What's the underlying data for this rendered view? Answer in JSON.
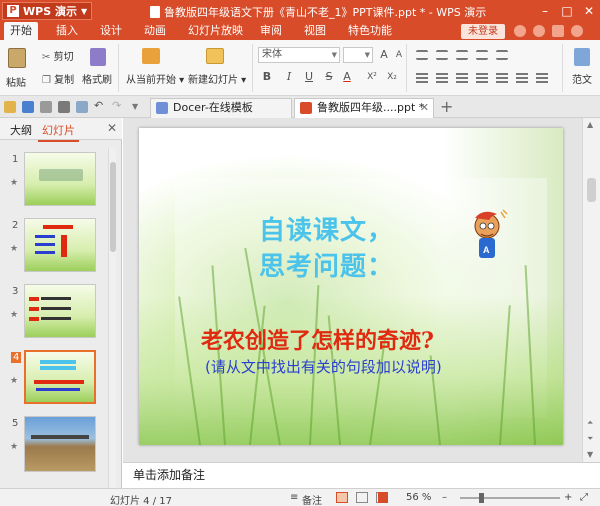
{
  "titlebar": {
    "app_name": "WPS 演示",
    "document_title": "鲁教版四年级语文下册《青山不老_1》PPT课件.ppt * - WPS 演示"
  },
  "menu": {
    "items": [
      "开始",
      "插入",
      "设计",
      "动画",
      "幻灯片放映",
      "审阅",
      "视图",
      "特色功能"
    ],
    "login_label": "未登录"
  },
  "ribbon": {
    "paste": "粘贴",
    "cut": "剪切",
    "copy": "复制",
    "format_painter": "格式刷",
    "from_current": "从当前开始",
    "new_slide": "新建幻灯片",
    "font_name": "宋体",
    "font_size": "",
    "bold": "B",
    "italic": "I",
    "underline": "U",
    "strike": "S",
    "superscript": "X²",
    "subscript": "X₂",
    "font_color": "A",
    "paragraph_format": "范文"
  },
  "tabs": [
    {
      "label": "Docer-在线模板",
      "active": false
    },
    {
      "label": "鲁教版四年级....ppt *",
      "active": true
    }
  ],
  "left_panel": {
    "tab_outline": "大纲",
    "tab_slides": "幻灯片",
    "slides": [
      {
        "num": "1",
        "active": false
      },
      {
        "num": "2",
        "active": false
      },
      {
        "num": "3",
        "active": false
      },
      {
        "num": "4",
        "active": true
      },
      {
        "num": "5",
        "active": false
      }
    ]
  },
  "slide": {
    "line1": "自读课文，",
    "line2": "思考问题：",
    "question": "老农创造了怎样的奇迹?",
    "hint": "(请从文中找出有关的句段加以说明)"
  },
  "notes_placeholder": "单击添加备注",
  "status": {
    "slide_counter": "幻灯片 4 / 17",
    "notes_button": "备注",
    "zoom": "56 %"
  },
  "colors": {
    "brand": "#d84c2a",
    "slide_heading": "#4cc3ea",
    "slide_question": "#e02a10",
    "slide_hint": "#2a3fd0"
  }
}
